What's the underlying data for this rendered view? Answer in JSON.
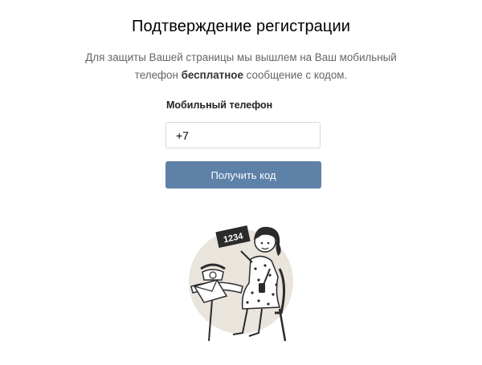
{
  "header": {
    "title": "Подтверждение регистрации"
  },
  "description": {
    "part1": "Для защиты Вашей страницы мы вышлем на Ваш мобильный телефон ",
    "bold": "бесплатное",
    "part2": " сообщение с кодом."
  },
  "form": {
    "phone_label": "Мобильный телефон",
    "phone_value": "+7",
    "submit_label": "Получить код"
  },
  "illustration": {
    "sign_code": "1234",
    "icon": "girl-with-phone-illustration"
  },
  "colors": {
    "accent": "#5e81a8",
    "circle": "#e9e5dc",
    "ink": "#2b2b2b"
  }
}
